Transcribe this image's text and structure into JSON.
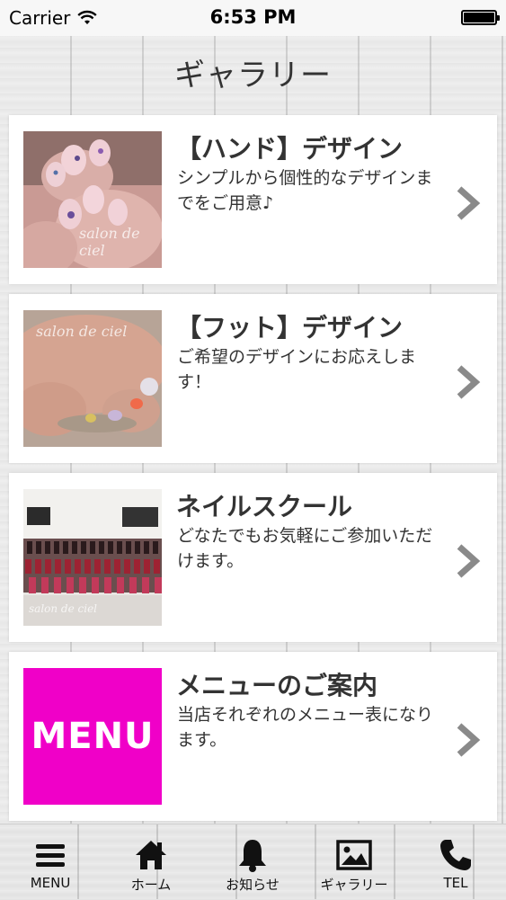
{
  "status_bar": {
    "carrier": "Carrier",
    "time": "6:53 PM"
  },
  "header": {
    "title": "ギャラリー"
  },
  "gallery": [
    {
      "title": "【ハンド】デザイン",
      "desc": "シンプルから個性的なデザインまでをご用意♪",
      "thumb_text": "salon de ciel"
    },
    {
      "title": "【フット】デザイン",
      "desc": "ご希望のデザインにお応えします！",
      "thumb_text": "salon de ciel"
    },
    {
      "title": "ネイルスクール",
      "desc": "どなたでもお気軽にご参加いただけます。",
      "thumb_text": "salon de ciel"
    },
    {
      "title": "メニューのご案内",
      "desc": "当店それぞれのメニュー表になります。",
      "thumb_text": "MENU"
    }
  ],
  "tabs": [
    {
      "label": "MENU",
      "icon": "hamburger-icon"
    },
    {
      "label": "ホーム",
      "icon": "home-icon"
    },
    {
      "label": "お知らせ",
      "icon": "bell-icon"
    },
    {
      "label": "ギャラリー",
      "icon": "image-icon"
    },
    {
      "label": "TEL",
      "icon": "phone-icon"
    }
  ],
  "colors": {
    "menu_thumb": "#f000c8",
    "chevron": "#8a8a8a"
  }
}
